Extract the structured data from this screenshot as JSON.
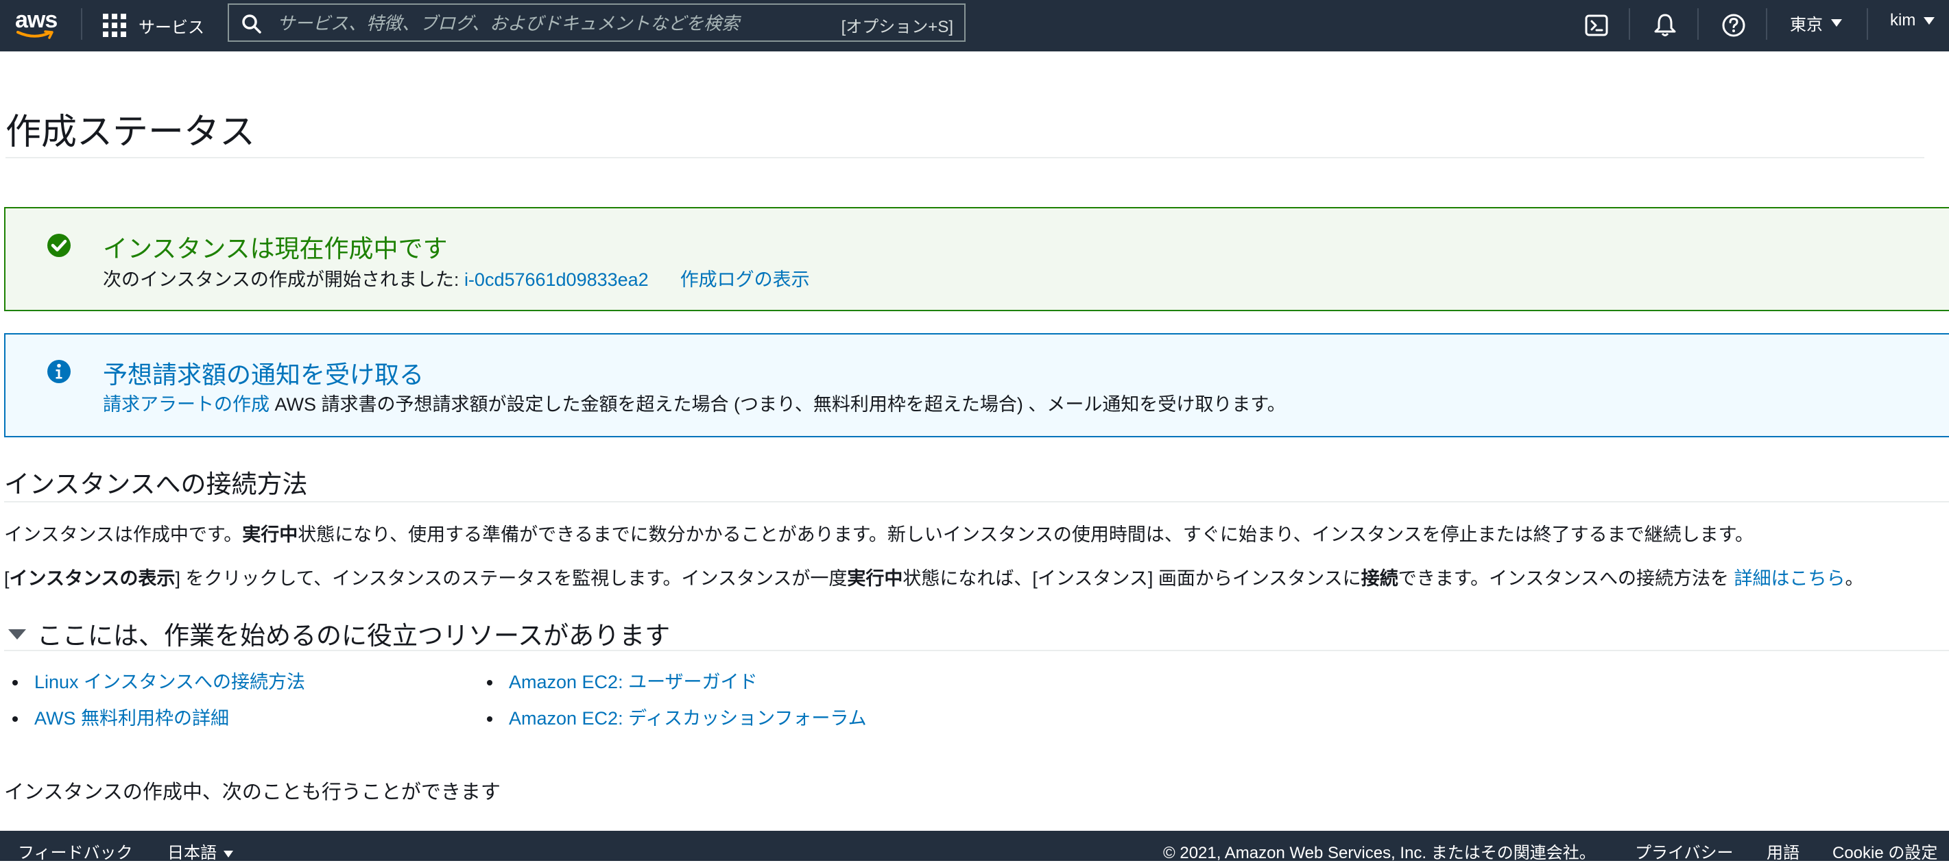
{
  "nav": {
    "logo_text": "aws",
    "services_label": "サービス",
    "search_placeholder": "サービス、特徴、ブログ、およびドキュメントなどを検索",
    "search_shortcut": "[オプション+S]",
    "region": "東京",
    "user": "kim"
  },
  "page": {
    "title": "作成ステータス"
  },
  "success_alert": {
    "title": "インスタンスは現在作成中です",
    "body_prefix": "次のインスタンスの作成が開始されました: ",
    "instance_id": "i-0cd57661d09833ea2",
    "log_link": "作成ログの表示"
  },
  "info_alert": {
    "title": "予想請求額の通知を受け取る",
    "link": "請求アラートの作成",
    "body": " AWS 請求書の予想請求額が設定した金額を超えた場合 (つまり、無料利用枠を超えた場合) 、メール通知を受け取ります。"
  },
  "connect_section": {
    "heading": "インスタンスへの接続方法",
    "p1_a": "インスタンスは作成中です。",
    "p1_b": "実行中",
    "p1_c": "状態になり、使用する準備ができるまでに数分かかることがあります。新しいインスタンスの使用時間は、すぐに始まり、インスタンスを停止または終了するまで継続します。",
    "p2_a": "[",
    "p2_b": "インスタンスの表示",
    "p2_c": "] をクリックして、インスタンスのステータスを監視します。インスタンスが一度",
    "p2_d": "実行中",
    "p2_e": "状態になれば、[インスタンス] 画面からインスタンスに",
    "p2_f": "接続",
    "p2_g": "できます。インスタンスへの接続方法を ",
    "p2_link": "詳細はこちら",
    "p2_h": "。"
  },
  "resources_section": {
    "heading": "ここには、作業を始めるのに役立つリソースがあります",
    "col1": [
      "Linux インスタンスへの接続方法",
      "AWS 無料利用枠の詳細"
    ],
    "col2": [
      "Amazon EC2: ユーザーガイド",
      "Amazon EC2: ディスカッションフォーラム"
    ]
  },
  "bottom_text": "インスタンスの作成中、次のことも行うことができます",
  "footer": {
    "feedback": "フィードバック",
    "language": "日本語",
    "copyright": "© 2021, Amazon Web Services, Inc. またはその関連会社。",
    "privacy": "プライバシー",
    "terms": "用語",
    "cookie": "Cookie の設定"
  },
  "colors": {
    "nav_bg": "#232f3e",
    "success": "#1d8102",
    "info": "#0073bb",
    "link": "#0073bb"
  }
}
